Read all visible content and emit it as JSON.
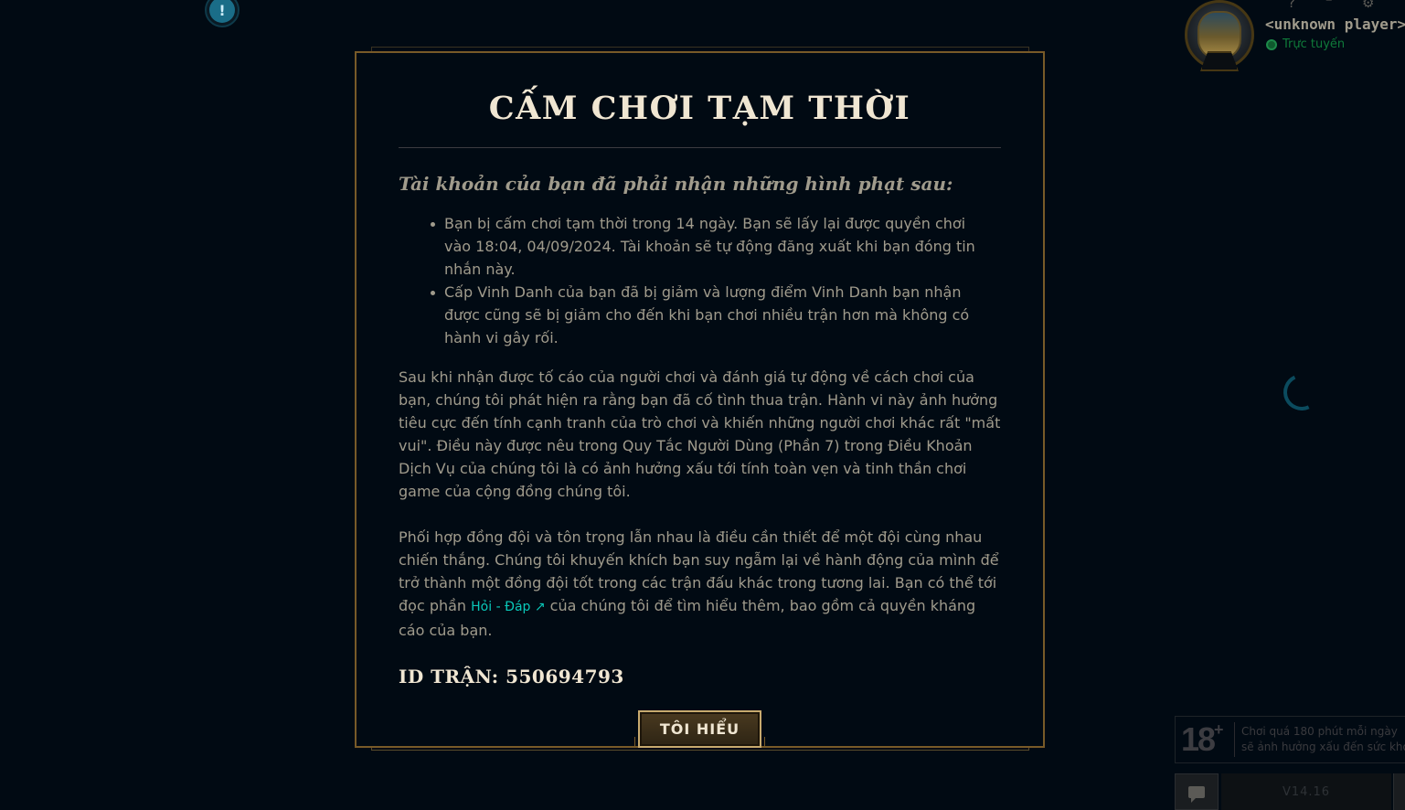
{
  "window": {
    "help_glyph": "?",
    "minimize_glyph": "–",
    "settings_glyph": "⚙",
    "alert_glyph": "!"
  },
  "profile": {
    "name": "<unknown player>",
    "status": "Trực tuyến",
    "status_color": "#1d8a4a"
  },
  "age_notice": {
    "badge": "18",
    "badge_plus": "+",
    "line1": "Chơi quá 180 phút mỗi ngày",
    "line2": "sẽ ảnh hưởng xấu đến sức khỏe"
  },
  "footer": {
    "version": "V14.16"
  },
  "modal": {
    "title": "CẤM CHƠI TẠM THỜI",
    "penalty_heading": "Tài khoản của bạn đã phải nhận những hình phạt sau:",
    "penalties": [
      "Bạn bị cấm chơi tạm thời trong 14 ngày. Bạn sẽ lấy lại được quyền chơi vào 18:04, 04/09/2024. Tài khoản sẽ tự động đăng xuất khi bạn đóng tin nhắn này.",
      "Cấp Vinh Danh của bạn đã bị giảm và lượng điểm Vinh Danh bạn nhận được cũng sẽ bị giảm cho đến khi bạn chơi nhiều trận hơn mà không có hành vi gây rối."
    ],
    "paragraph1": "Sau khi nhận được tố cáo của người chơi và đánh giá tự động về cách chơi của bạn, chúng tôi phát hiện ra rằng bạn đã cố tình thua trận. Hành vi này ảnh hưởng tiêu cực đến tính cạnh tranh của trò chơi và khiến những người chơi khác rất \"mất vui\". Điều này được nêu trong Quy Tắc Người Dùng (Phần 7) trong Điều Khoản Dịch Vụ của chúng tôi là có ảnh hưởng xấu tới tính toàn vẹn và tinh thần chơi game của cộng đồng chúng tôi.",
    "paragraph2_before": "Phối hợp đồng đội và tôn trọng lẫn nhau là điều cần thiết để một đội cùng nhau chiến thắng. Chúng tôi khuyến khích bạn suy ngẫm lại về hành động của mình để trở thành một đồng đội tốt trong các trận đấu khác trong tương lai. Bạn có thể tới đọc phần ",
    "faq_link": "Hỏi - Đáp",
    "paragraph2_after": " của chúng tôi để tìm hiểu thêm, bao gồm cả quyền kháng cáo của bạn.",
    "match_id": "ID TRẬN: 550694793",
    "confirm_label": "TÔI HIỂU",
    "accent_color": "#c8aa6e",
    "link_color": "#0ac8b9"
  }
}
